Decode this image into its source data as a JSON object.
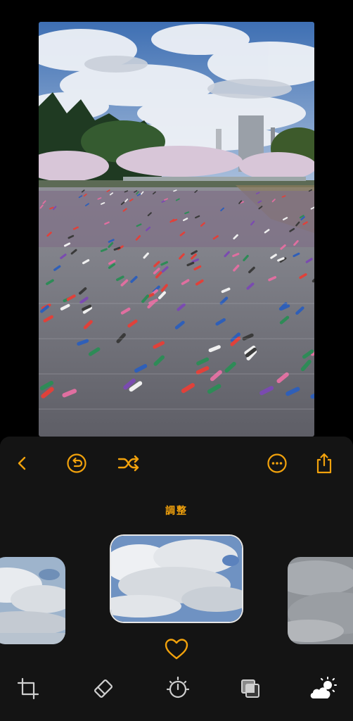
{
  "toolbar": {
    "back": "chevron-left-icon",
    "revert": "revert-icon",
    "shuffle": "shuffle-icon",
    "more": "more-icon",
    "share": "share-icon"
  },
  "section_label": "調整",
  "thumbnails": [
    {
      "name": "sky-preset-left",
      "selected": false
    },
    {
      "name": "sky-preset-center",
      "selected": true
    },
    {
      "name": "sky-preset-right",
      "selected": false
    }
  ],
  "tools": [
    "crop-icon",
    "eraser-icon",
    "adjust-dial-icon",
    "overlay-icon",
    "sky-weather-icon"
  ],
  "colors": {
    "accent": "#f2a20c",
    "panel": "#141414",
    "active_tool": "#ffffff",
    "inactive_tool": "#cfcfcf"
  }
}
